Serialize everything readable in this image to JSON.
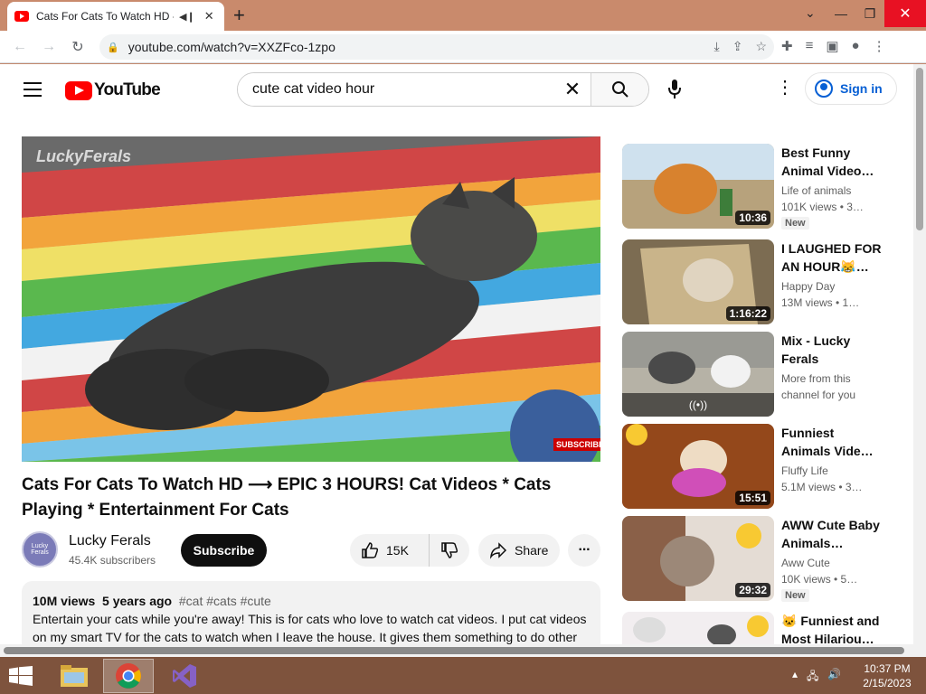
{
  "browser": {
    "tab_title": "Cats For Cats To Watch HD -",
    "url": "youtube.com/watch?v=XXZFco-1zpo"
  },
  "youtube": {
    "logo_text": "YouTube",
    "search_value": "cute cat video hour",
    "signin_label": "Sign in"
  },
  "player": {
    "watermark": "LuckyFerals",
    "subscribe_overlay": "SUBSCRIBE"
  },
  "video": {
    "title": "Cats For Cats To Watch HD ⟶ EPIC 3 HOURS! Cat Videos * Cats Playing * Entertainment For Cats",
    "channel": "Lucky Ferals",
    "subscribers": "45.4K subscribers",
    "subscribe_label": "Subscribe",
    "likes": "15K",
    "share_label": "Share",
    "views": "10M views",
    "age": "5 years ago",
    "tags": "#cat #cats #cute",
    "description": "Entertain your cats while you're away! This is for cats who love to watch cat videos. I put cat videos on my smart TV for the cats to watch when I leave the house. It gives them something to do other",
    "avatar_text": "Lucky Ferals"
  },
  "recommendations": [
    {
      "title": "Best Funny Animal Video…",
      "channel": "Life of animals",
      "views": "101K views • 3…",
      "duration": "10:36",
      "badge": "New"
    },
    {
      "title": "I LAUGHED FOR AN HOUR😹…",
      "channel": "Happy Day",
      "views": "13M views • 1…",
      "duration": "1:16:22",
      "badge": ""
    },
    {
      "title": "Mix - Lucky Ferals",
      "channel": "More from this",
      "views": "channel for you",
      "duration": "",
      "badge": ""
    },
    {
      "title": "Funniest Animals Vide…",
      "channel": "Fluffy Life",
      "views": "5.1M views • 3…",
      "duration": "15:51",
      "badge": ""
    },
    {
      "title": "AWW Cute Baby Animals…",
      "channel": "Aww Cute",
      "views": "10K views • 5…",
      "duration": "29:32",
      "badge": "New"
    },
    {
      "title": "🐱 Funniest and Most Hilariou…",
      "channel": "",
      "views": "",
      "duration": "",
      "badge": ""
    }
  ],
  "taskbar": {
    "time": "10:37 PM",
    "date": "2/15/2023"
  },
  "colors": {
    "yt_red": "#ff0000",
    "link_blue": "#065fd4",
    "desktop": "#c98a6c"
  }
}
